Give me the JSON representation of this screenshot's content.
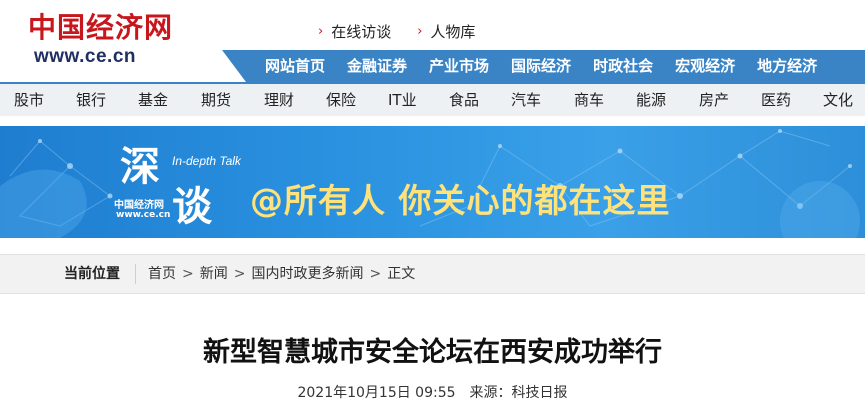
{
  "header": {
    "logo_cn": "中国经济网",
    "logo_en": "www.ce.cn",
    "quick_links": [
      {
        "label": "在线访谈"
      },
      {
        "label": "人物库"
      }
    ]
  },
  "main_nav": [
    "网站首页",
    "金融证券",
    "产业市场",
    "国际经济",
    "时政社会",
    "宏观经济",
    "地方经济"
  ],
  "categories": [
    "股市",
    "银行",
    "基金",
    "期货",
    "理财",
    "保险",
    "IT业",
    "食品",
    "汽车",
    "商车",
    "能源",
    "房产",
    "医药",
    "文化"
  ],
  "banner": {
    "title_char_1": "深",
    "title_char_2": "谈",
    "subtitle_en": "In-depth Talk",
    "brand_cn": "中国经济网",
    "brand_en": "www.ce.cn",
    "slogan": "@所有人 你关心的都在这里",
    "colors": {
      "background": "#2a92e0",
      "slogan": "#ffe27a"
    }
  },
  "breadcrumb": {
    "label": "当前位置",
    "items": [
      "首页",
      "新闻",
      "国内时政更多新闻",
      "正文"
    ],
    "separator": ">"
  },
  "article": {
    "title": "新型智慧城市安全论坛在西安成功举行",
    "datetime": "2021年10月15日 09:55",
    "source_label": "来源：",
    "source": "科技日报"
  },
  "colors": {
    "brand_red": "#c8161d",
    "nav_blue": "#3a84c6",
    "category_bar_bg": "#eef1f4"
  }
}
